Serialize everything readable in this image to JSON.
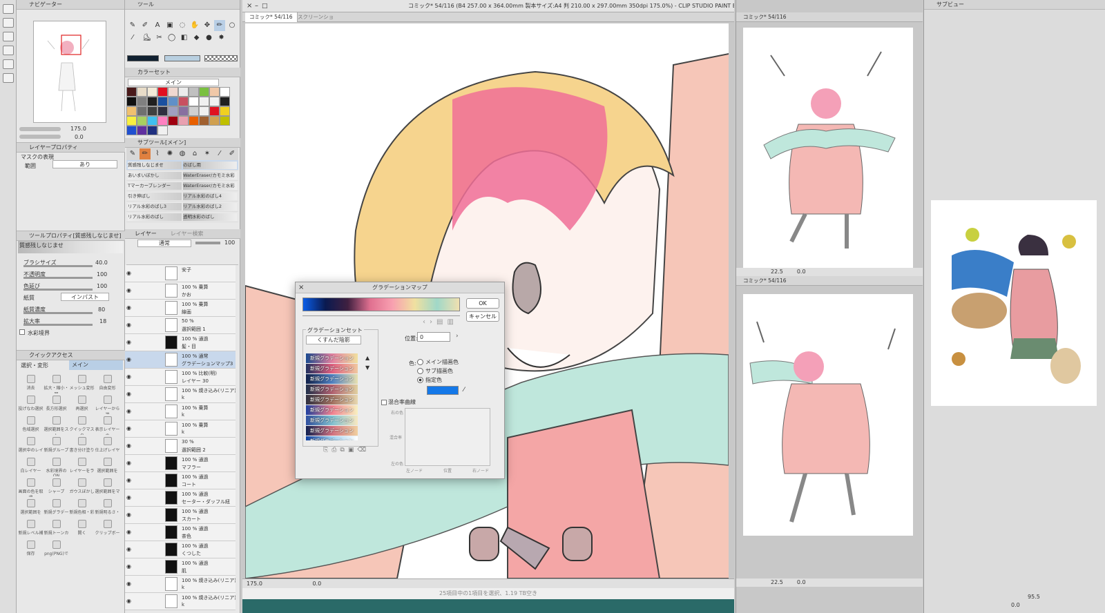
{
  "window_title": "コミック* 54/116 (B4 257.00 x 364.00mm 製本サイズ:A4 判 210.00 x 297.00mm 350dpi 175.0%) - CLIP STUDIO PAINT EX",
  "navigator": {
    "title": "ナビゲーター",
    "zoom": "175.0",
    "rotation": "0.0"
  },
  "layer_property": {
    "title": "レイヤープロパティ",
    "section": "マスクの表現",
    "row_label": "範囲",
    "row_value": "あり"
  },
  "tool_property": {
    "title": "ツールプロパティ[質感残しなじませ]",
    "preset_name": "質感残しなじませ",
    "params": [
      {
        "label": "ブラシサイズ",
        "value": "40.0"
      },
      {
        "label": "不透明度",
        "value": "100"
      },
      {
        "label": "色延び",
        "value": "100"
      },
      {
        "label": "紙質",
        "value": "インパスト"
      },
      {
        "label": "紙質濃度",
        "value": "80"
      },
      {
        "label": "拡大率",
        "value": "18"
      },
      {
        "label": "水彩境界",
        "value": ""
      }
    ]
  },
  "quick_access": {
    "title": "クイックアクセス",
    "tabs": [
      "選択・変形",
      "メイン"
    ],
    "items": [
      "消去",
      "拡大・縮小・回",
      "メッシュ変形",
      "自由変形",
      "投げなわ選択",
      "長方形選択",
      "再選択",
      "レイヤーから選",
      "色域選択",
      "選択範囲をスト",
      "クイックマスク",
      "表示レイヤーの",
      "選択中のレイ",
      "新規グループ",
      "書き分け塗り",
      "仕上げレイヤー",
      "白レイヤー",
      "水彩境界のON",
      "レイヤーをラ",
      "選択範囲を",
      "画面の色を取得",
      "シャープ",
      "ガウスぼかし",
      "選択範囲をマ",
      "選択範囲を",
      "新規グラデー",
      "新規色相・彩",
      "新規明るさ・",
      "新規レベル補",
      "新規トーンカー",
      "開く",
      "クリップボー",
      "保存",
      "png(PNG)で"
    ]
  },
  "tool_panel": {
    "title": "ツール"
  },
  "color_set": {
    "title": "カラーセット",
    "set_name": "メイン",
    "swatches": [
      "#4a1a1a",
      "#e8dcc8",
      "#f2ead8",
      "#e01020",
      "#f0d8d0",
      "#ececec",
      "#c0c0c0",
      "#7ac040",
      "#f0c8a8",
      "#ffffff",
      "#101010",
      "#808080",
      "#202020",
      "#1a50a0",
      "#6090c8",
      "#c85060",
      "#ffffff",
      "#f0f0f0",
      "#f0f0f0",
      "#202020",
      "#f0c070",
      "#707070",
      "#404040",
      "#303040",
      "#a0a0c0",
      "#8870a0",
      "#d0d0d0",
      "#f0f0f0",
      "#e01020",
      "#f0d020",
      "#f8f040",
      "#a8d060",
      "#40c0f0",
      "#ff80c0",
      "#a00010",
      "#e8a0b0",
      "#e86000",
      "#a06030",
      "#d0a050",
      "#c0c000",
      "#2050d0",
      "#6030a0",
      "#203080",
      "#f0f0f0"
    ]
  },
  "subtool": {
    "title": "サブツール[メイン]",
    "items": [
      {
        "left": "質感残しなじませ",
        "right": "のばし用"
      },
      {
        "left": "あいまいぼかし",
        "right": "WaterEraser/カモミ水彩水"
      },
      {
        "left": "Tマーカーブレンダー",
        "right": "WaterEraser/カモミ水彩水"
      },
      {
        "left": "引き伸ばし",
        "right": "リアル水彩のばし4"
      },
      {
        "left": "リアル水彩のばし3",
        "right": "リアル水彩のばし2"
      },
      {
        "left": "リアル水彩のばし",
        "right": "透明水彩のばし"
      }
    ]
  },
  "layer_panel": {
    "tabs": [
      "レイヤー",
      "レイヤー検索"
    ],
    "blend_mode": "通常",
    "opacity": "100",
    "layers": [
      {
        "line1": "安子",
        "line2": ""
      },
      {
        "line1": "100 % 乗算",
        "line2": "かお"
      },
      {
        "line1": "100 % 乗算",
        "line2": "線画"
      },
      {
        "line1": "50 %",
        "line2": "選択範囲 1"
      },
      {
        "line1": "100 % 通過",
        "line2": "髪・目"
      },
      {
        "line1": "100 % 通常",
        "line2": "グラデーションマップ3"
      },
      {
        "line1": "100 % 比較(明)",
        "line2": "レイヤー 30"
      },
      {
        "line1": "100 % 焼き込み(リニア)",
        "line2": "k"
      },
      {
        "line1": "100 % 乗算",
        "line2": "k"
      },
      {
        "line1": "100 % 乗算",
        "line2": "k"
      },
      {
        "line1": "30 %",
        "line2": "選択範囲 2"
      },
      {
        "line1": "100 % 通過",
        "line2": "マフラー"
      },
      {
        "line1": "100 % 通過",
        "line2": "コート"
      },
      {
        "line1": "100 % 通過",
        "line2": "セーター・ダッフル紐"
      },
      {
        "line1": "100 % 通過",
        "line2": "スカート"
      },
      {
        "line1": "100 % 通過",
        "line2": "茶色"
      },
      {
        "line1": "100 % 通過",
        "line2": "くつした"
      },
      {
        "line1": "100 % 通過",
        "line2": "肌"
      },
      {
        "line1": "100 % 焼き込み(リニア)",
        "line2": "k"
      },
      {
        "line1": "100 % 焼き込み(リニア)",
        "line2": "k"
      }
    ]
  },
  "canvas_tabs": [
    "コミック* 54/116",
    "スクリーンショ"
  ],
  "canvas_status": {
    "zoom": "175.0",
    "rot": "0.0"
  },
  "bottom_status": "25項目中の1項目を選択、1.19 TB空き",
  "right_view_1": {
    "tab": "コミック* 54/116",
    "zoom": "22.5",
    "rot": "0.0"
  },
  "right_view_2": {
    "tab": "コミック* 54/116",
    "zoom": "22.5",
    "rot": "0.0"
  },
  "subview": {
    "title": "サブビュー",
    "zoom": "95.5",
    "rot": "0.0"
  },
  "gradient_dialog": {
    "title": "グラデーションマップ",
    "ok": "OK",
    "cancel": "キャンセル",
    "set_label": "グラデーションセット",
    "set_value": "くすんだ陰影",
    "position_label": "位置:",
    "position_value": "0",
    "color_label": "色:",
    "color_options": [
      "メイン描画色",
      "サブ描画色",
      "指定色"
    ],
    "selected_option": "指定色",
    "specified_color": "#1478e8",
    "mix_curve_label": "混合率曲線",
    "curve_y_top": "右の色",
    "curve_y_mid": "混合率",
    "curve_y_bottom": "左の色",
    "curve_x": [
      "左ノード",
      "位置",
      "右ノード"
    ],
    "gradients": [
      {
        "name": "新規グラデーション 15",
        "colors": [
          "#1a4a90",
          "#e080a0",
          "#f0e0a0"
        ]
      },
      {
        "name": "新規グラデーション 37",
        "colors": [
          "#203060",
          "#e06080",
          "#f0c8a0"
        ]
      },
      {
        "name": "新規グラデーション 41",
        "colors": [
          "#10204a",
          "#5080c0",
          "#e8e0b0"
        ]
      },
      {
        "name": "新規グラデーション 27",
        "colors": [
          "#20304a",
          "#b06070",
          "#e0d0a0"
        ]
      },
      {
        "name": "新規グラデーション 18",
        "colors": [
          "#303040",
          "#a07060",
          "#e8d8b0"
        ]
      },
      {
        "name": "新規グラデーション 31",
        "colors": [
          "#2040a0",
          "#f08090",
          "#f8f0c0"
        ]
      },
      {
        "name": "新規グラデーション 17",
        "colors": [
          "#3050a0",
          "#80c0d0",
          "#f8e8c0"
        ]
      },
      {
        "name": "新規グラデーション 42",
        "colors": [
          "#102050",
          "#d07080",
          "#f0d0a0"
        ]
      },
      {
        "name": "新規グラデーション 4",
        "colors": [
          "#1040a0",
          "#a0d0f0",
          "#ffffff"
        ]
      }
    ],
    "main_gradient": [
      "#0a5de8",
      "#0a1a50",
      "#402040",
      "#e07090",
      "#f8a0b0",
      "#f0e0a0",
      "#a0d8c8",
      "#f0e0b0"
    ]
  }
}
